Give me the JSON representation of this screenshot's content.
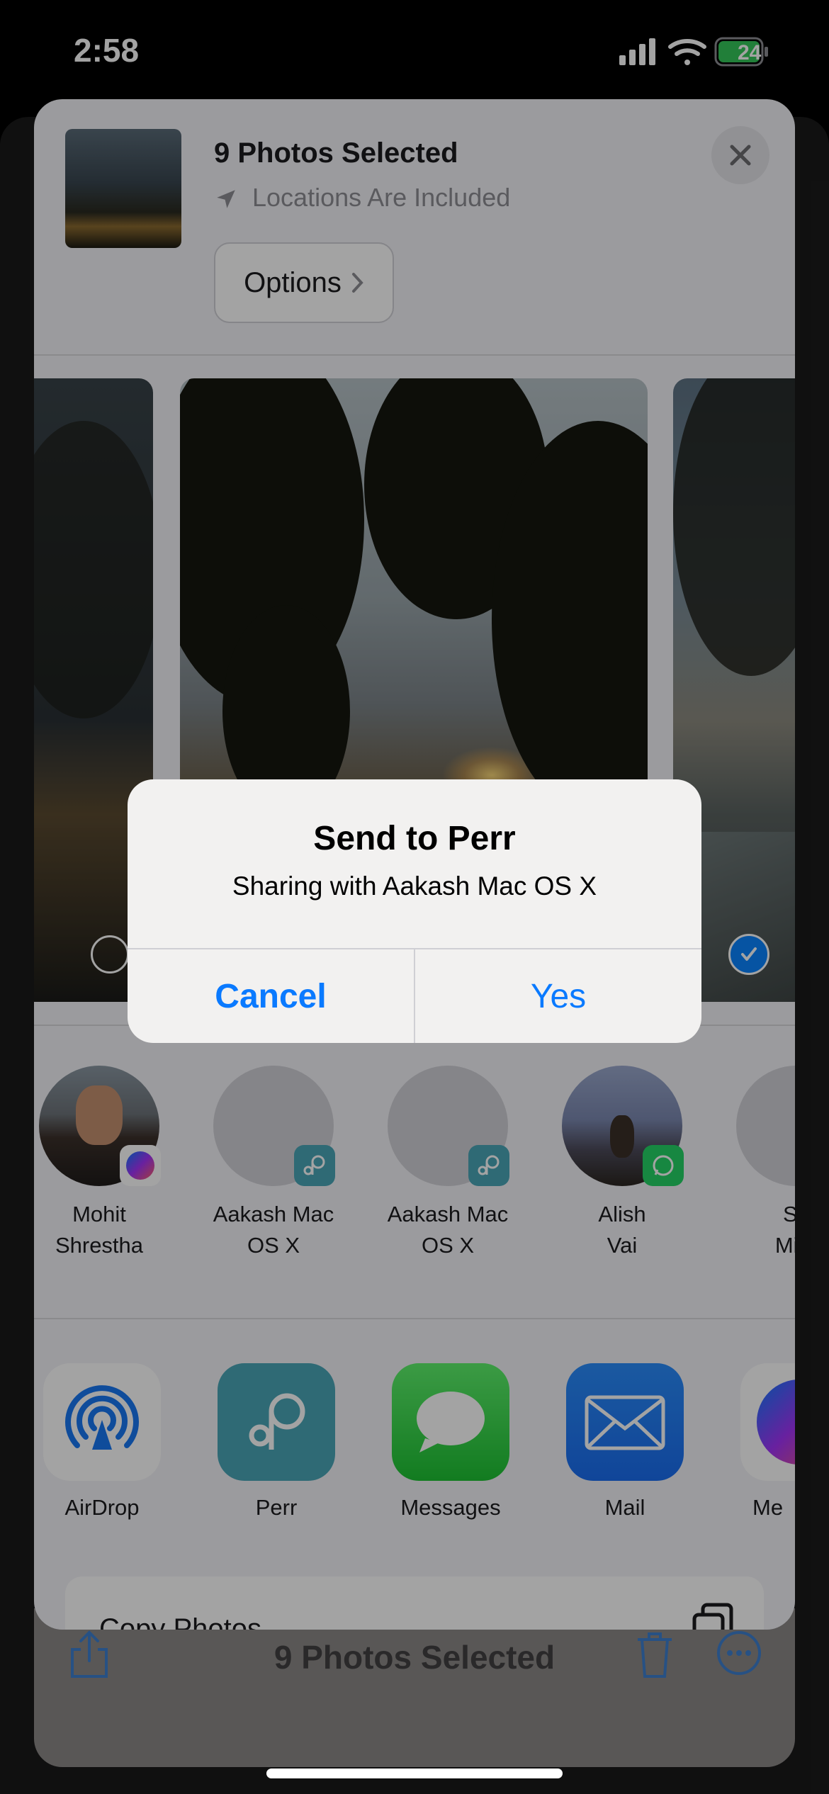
{
  "status_bar": {
    "time": "2:58",
    "battery": "24"
  },
  "share_sheet": {
    "title": "9 Photos Selected",
    "location_note": "Locations Are Included",
    "options_label": "Options"
  },
  "contacts": [
    {
      "name_line1": "Mohit",
      "name_line2": "Shrestha",
      "badge": "messenger-icon"
    },
    {
      "name_line1": "Aakash Mac",
      "name_line2": "OS X",
      "badge": "perr-icon"
    },
    {
      "name_line1": "Aakash Mac",
      "name_line2": "OS X",
      "badge": "perr-icon"
    },
    {
      "name_line1": "Alish",
      "name_line2": "Vai",
      "badge": "whatsapp-icon"
    },
    {
      "name_line1": "Sh",
      "name_line2": "Mira"
    }
  ],
  "apps": [
    {
      "label": "AirDrop",
      "icon": "airdrop-icon"
    },
    {
      "label": "Perr",
      "icon": "perr-icon"
    },
    {
      "label": "Messages",
      "icon": "messages-icon"
    },
    {
      "label": "Mail",
      "icon": "mail-icon"
    },
    {
      "label": "Me",
      "icon": "messenger-icon"
    }
  ],
  "actions": {
    "copy_photos": "Copy Photos"
  },
  "alert": {
    "title": "Send to Perr",
    "message": "Sharing with Aakash Mac OS X",
    "cancel": "Cancel",
    "confirm": "Yes"
  },
  "bottom_toolbar": {
    "title": "9 Photos Selected"
  },
  "colors": {
    "accent": "#0a7aff",
    "sheet_bg": "#f2f2f7",
    "battery_green": "#34c759"
  }
}
